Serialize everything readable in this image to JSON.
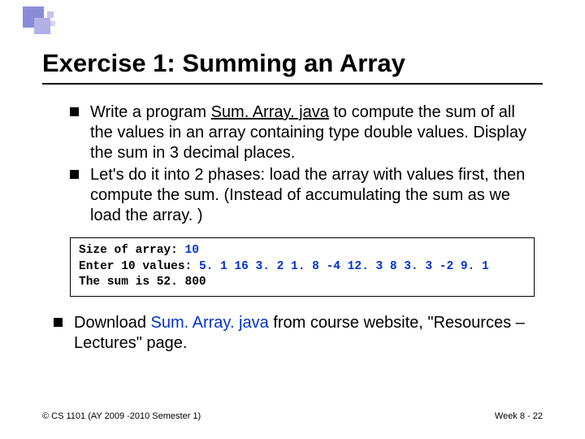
{
  "title": "Exercise 1: Summing an Array",
  "bullets": {
    "b1": {
      "pre": "Write a program ",
      "file": "Sum. Array. java",
      "post": " to compute the sum of all the values in an array containing type double values. Display the sum in 3 decimal places."
    },
    "b2": "Let's do it into 2 phases: load the array with values first, then compute the sum. (Instead of accumulating the sum as we load the array. )"
  },
  "code": {
    "l1": {
      "label": "Size of array: ",
      "val": "10"
    },
    "l2": {
      "label": "Enter 10 values: ",
      "val": "5. 1 16 3. 2 1. 8 -4 12. 3 8 3. 3 -2 9. 1"
    },
    "l3": "The sum is 52. 800"
  },
  "bullets2": {
    "b3": {
      "pre": "Download ",
      "file": "Sum. Array. java",
      "post": " from course website, \"Resources – Lectures\" page."
    }
  },
  "footer": {
    "left": "© CS 1101 (AY 2009 -2010 Semester 1)",
    "right": "Week 8 - 22"
  }
}
